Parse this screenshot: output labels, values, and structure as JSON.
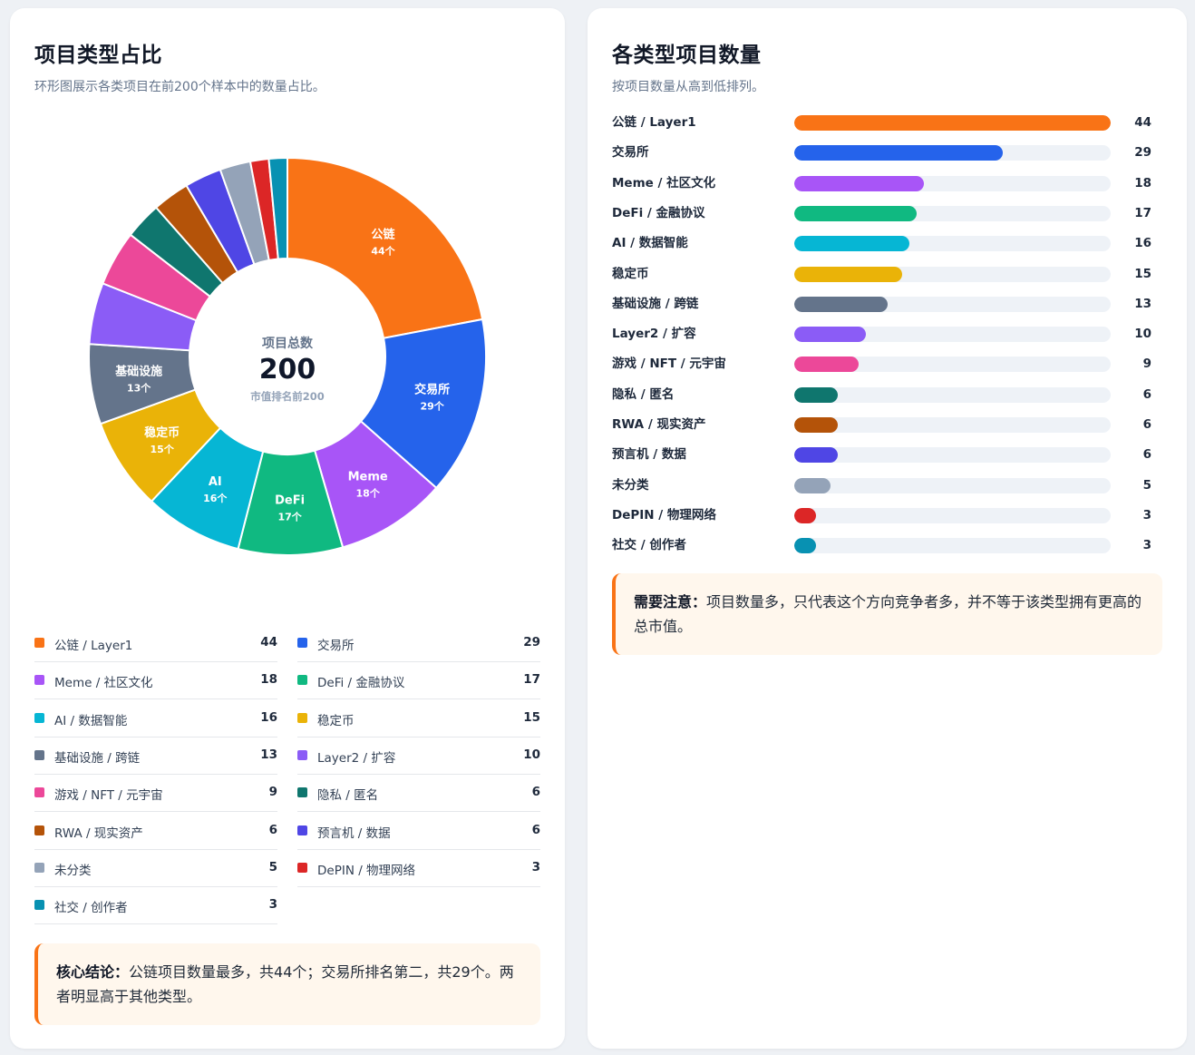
{
  "left": {
    "title": "项目类型占比",
    "subtitle": "环形图展示各类项目在前200个样本中的数量占比。",
    "center": {
      "label": "项目总数",
      "value": "200",
      "sub": "市值排名前200"
    },
    "note": {
      "bold": "核心结论：",
      "text": "公链项目数量最多，共44个；交易所排名第二，共29个。两者明显高于其他类型。"
    }
  },
  "right": {
    "title": "各类型项目数量",
    "subtitle": "按项目数量从高到低排列。",
    "note": {
      "bold": "需要注意：",
      "text": "项目数量多，只代表这个方向竞争者多，并不等于该类型拥有更高的总市值。"
    }
  },
  "chart_data": [
    {
      "type": "pie",
      "variant": "donut",
      "title": "项目类型占比",
      "total": 200,
      "slices": [
        {
          "name": "公链 / Layer1",
          "short": "公链",
          "value": 44,
          "color": "#f97316",
          "inlabel": "公链",
          "invalue": "44个"
        },
        {
          "name": "交易所",
          "short": "交易所",
          "value": 29,
          "color": "#2563eb",
          "inlabel": "交易所",
          "invalue": "29个"
        },
        {
          "name": "Meme / 社区文化",
          "short": "Meme",
          "value": 18,
          "color": "#a855f7",
          "inlabel": "Meme",
          "invalue": "18个"
        },
        {
          "name": "DeFi / 金融协议",
          "short": "DeFi",
          "value": 17,
          "color": "#10b981",
          "inlabel": "DeFi",
          "invalue": "17个"
        },
        {
          "name": "AI / 数据智能",
          "short": "AI",
          "value": 16,
          "color": "#06b6d4",
          "inlabel": "AI",
          "invalue": "16个"
        },
        {
          "name": "稳定币",
          "short": "稳定币",
          "value": 15,
          "color": "#eab308",
          "inlabel": "稳定币",
          "invalue": "15个"
        },
        {
          "name": "基础设施 / 跨链",
          "short": "基础设施",
          "value": 13,
          "color": "#64748b",
          "inlabel": "基础设施",
          "invalue": "13个"
        },
        {
          "name": "Layer2 / 扩容",
          "short": "Layer2",
          "value": 10,
          "color": "#8b5cf6",
          "inlabel": "",
          "invalue": ""
        },
        {
          "name": "游戏 / NFT / 元宇宙",
          "short": "游戏",
          "value": 9,
          "color": "#ec4899",
          "inlabel": "",
          "invalue": ""
        },
        {
          "name": "隐私 / 匿名",
          "short": "隐私",
          "value": 6,
          "color": "#0f766e",
          "inlabel": "",
          "invalue": ""
        },
        {
          "name": "RWA / 现实资产",
          "short": "RWA",
          "value": 6,
          "color": "#b45309",
          "inlabel": "",
          "invalue": ""
        },
        {
          "name": "预言机 / 数据",
          "short": "预言机",
          "value": 6,
          "color": "#4f46e5",
          "inlabel": "",
          "invalue": ""
        },
        {
          "name": "未分类",
          "short": "未分类",
          "value": 5,
          "color": "#94a3b8",
          "inlabel": "",
          "invalue": ""
        },
        {
          "name": "DePIN / 物理网络",
          "short": "DePIN",
          "value": 3,
          "color": "#dc2626",
          "inlabel": "",
          "invalue": ""
        },
        {
          "name": "社交 / 创作者",
          "short": "社交",
          "value": 3,
          "color": "#0891b2",
          "inlabel": "",
          "invalue": ""
        }
      ]
    },
    {
      "type": "bar",
      "orientation": "horizontal",
      "title": "各类型项目数量",
      "categories": [
        "公链 / Layer1",
        "交易所",
        "Meme / 社区文化",
        "DeFi / 金融协议",
        "AI / 数据智能",
        "稳定币",
        "基础设施 / 跨链",
        "Layer2 / 扩容",
        "游戏 / NFT / 元宇宙",
        "隐私 / 匿名",
        "RWA / 现实资产",
        "预言机 / 数据",
        "未分类",
        "DePIN / 物理网络",
        "社交 / 创作者"
      ],
      "values": [
        44,
        29,
        18,
        17,
        16,
        15,
        13,
        10,
        9,
        6,
        6,
        6,
        5,
        3,
        3
      ],
      "colors": [
        "#f97316",
        "#2563eb",
        "#a855f7",
        "#10b981",
        "#06b6d4",
        "#eab308",
        "#64748b",
        "#8b5cf6",
        "#ec4899",
        "#0f766e",
        "#b45309",
        "#4f46e5",
        "#94a3b8",
        "#dc2626",
        "#0891b2"
      ],
      "xlim": [
        0,
        44
      ]
    }
  ]
}
